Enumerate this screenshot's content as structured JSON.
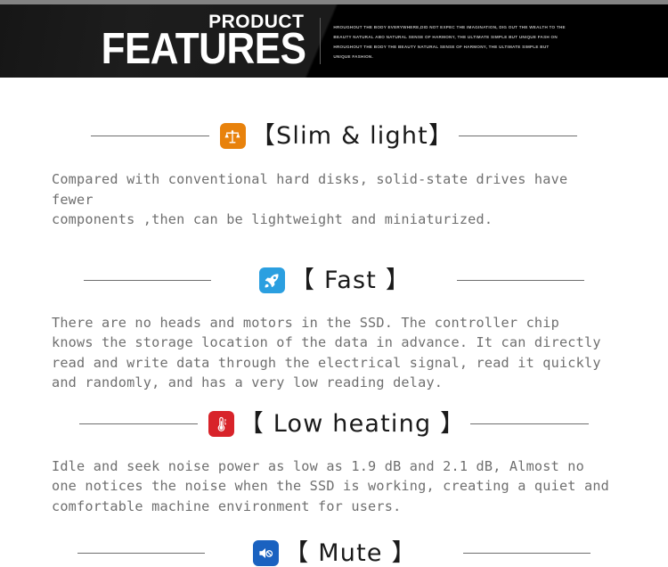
{
  "banner": {
    "title_small": "PRODUCT",
    "title_large": "FEATURES",
    "subtext": "HROUGHOUT THE BODY EVERYWHERE,DID NOT EXPEC THE IMAGINATION, DIG OUT THE WEALTH TO THE BEAUTY NATURAL ABO NATURAL SENSE OF HARMONY, THE ULTIMATE SIMPLE BUT UNIQUE FASH ON HROUGHOUT THE BODY THE BEAUTY NATURAL SENSE OF HARMONY, THE ULTIMATE SIMPLE BUT UNIQUE FASHION.",
    "colors": {
      "top_strip": "#838383",
      "background": "#1b1b1b",
      "wedge": "#000000",
      "text": "#ffffff",
      "subtext": "#b9b9b9",
      "divider": "#5e5e5e"
    }
  },
  "sections": [
    {
      "id": "slim-light",
      "icon_name": "balance-scale-icon",
      "icon_color": "#e8820c",
      "bracket_open": "【",
      "bracket_close": "】",
      "heading": "Slim & light",
      "body": "Compared with conventional hard disks, solid-state drives have fewer\ncomponents ,then can be lightweight and miniaturized."
    },
    {
      "id": "fast",
      "icon_name": "rocket-icon",
      "icon_color": "#2b9fe0",
      "bracket_open": "【",
      "bracket_close": "】",
      "heading": " Fast ",
      "body": "There are no heads and motors in the SSD. The controller chip\nknows the storage location of the data in advance. It can directly\nread and write data through the electrical signal, read it quickly\nand randomly, and has a very low reading delay."
    },
    {
      "id": "low-heating",
      "icon_name": "thermometer-icon",
      "icon_color": "#d8232a",
      "bracket_open": "【",
      "bracket_close": "】",
      "heading": " Low heating ",
      "body": "Idle and seek noise power as low as 1.9 dB and 2.1 dB, Almost no\none notices the noise when the SSD is working, creating a quiet and\ncomfortable machine environment for users."
    },
    {
      "id": "mute",
      "icon_name": "speaker-mute-icon",
      "icon_color": "#1a62c0",
      "bracket_open": "【",
      "bracket_close": "】",
      "heading": " Mute ",
      "body": ""
    }
  ],
  "theme": {
    "rule_color": "#6e6e6e",
    "heading_color": "#1a1a1a",
    "body_color": "#6f6f6f",
    "page_background": "#ffffff"
  }
}
